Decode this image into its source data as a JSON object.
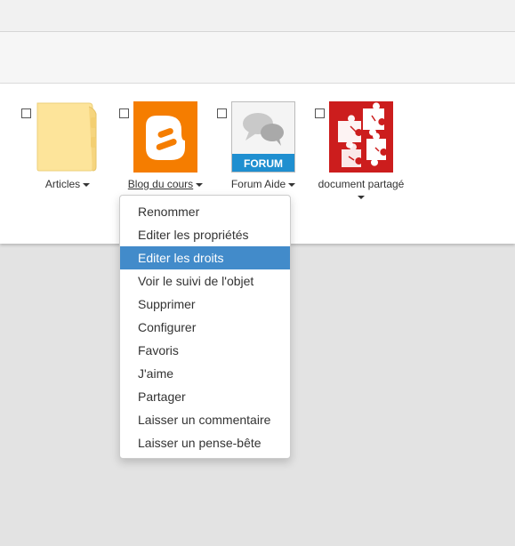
{
  "colors": {
    "accent": "#428bca",
    "blogger_orange": "#f57d00",
    "document_red": "#cc1d1d"
  },
  "items": [
    {
      "label": "Articles",
      "icon": "folder-icon",
      "has_caret": true
    },
    {
      "label": "Blog du cours",
      "icon": "blogger-icon",
      "has_caret": true,
      "underlined": true
    },
    {
      "label": "Forum Aide",
      "icon": "forum-icon",
      "badge": "FORUM",
      "has_caret": true
    },
    {
      "label": "document partagé",
      "icon": "puzzle-icon",
      "has_caret": true
    }
  ],
  "context_menu": {
    "items": [
      "Renommer",
      "Editer les propriétés",
      "Editer les droits",
      "Voir le suivi de l'objet",
      "Supprimer",
      "Configurer",
      "Favoris",
      "J'aime",
      "Partager",
      "Laisser un commentaire",
      "Laisser un pense-bête"
    ],
    "highlighted": "Editer les droits"
  }
}
